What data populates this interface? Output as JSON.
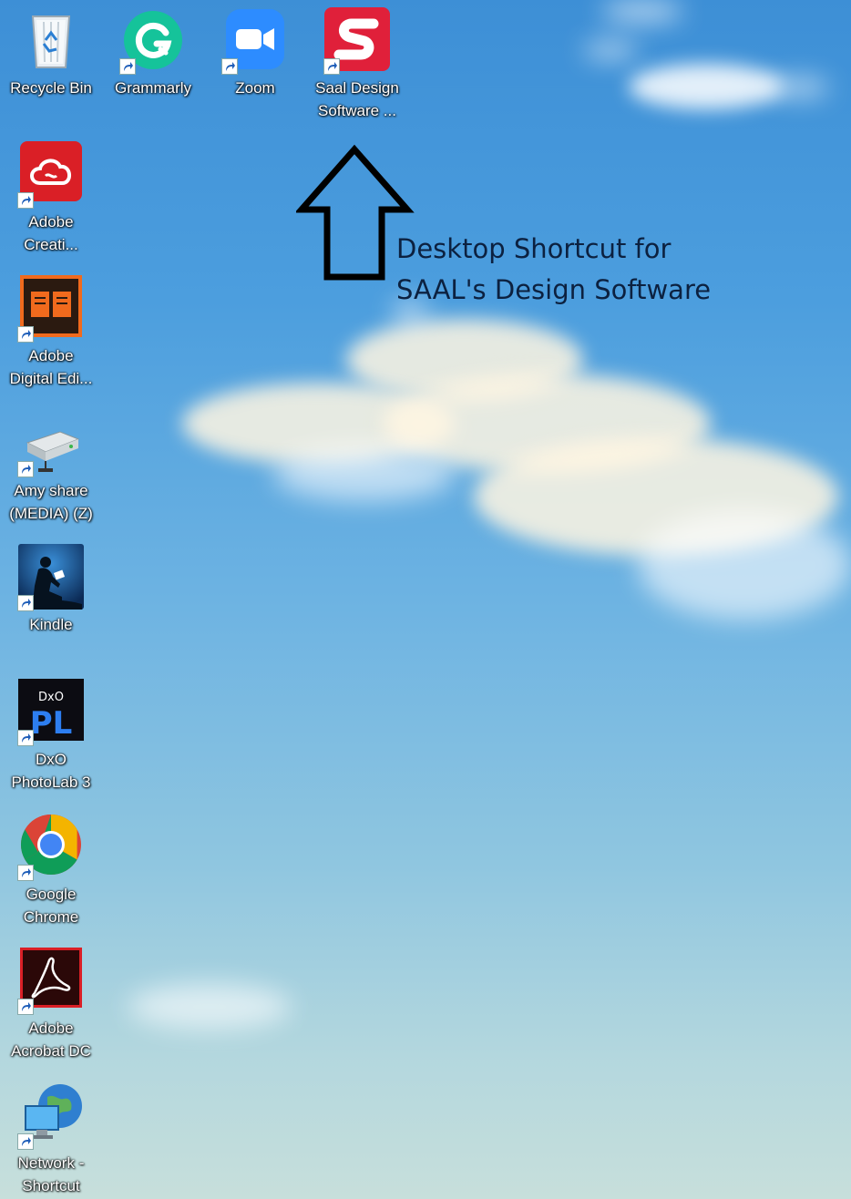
{
  "desktop": {
    "icons": [
      {
        "label": "Recycle Bin",
        "icon": "recycle-bin-icon",
        "shortcut": false
      },
      {
        "label": "Grammarly",
        "icon": "grammarly-icon",
        "shortcut": true
      },
      {
        "label": "Zoom",
        "icon": "zoom-icon",
        "shortcut": true
      },
      {
        "label": "Saal Design\nSoftware ...",
        "icon": "saal-design-icon",
        "shortcut": true
      },
      {
        "label": "Adobe\nCreati...",
        "icon": "adobe-creative-cloud-icon",
        "shortcut": true
      },
      {
        "label": "Adobe\nDigital Edi...",
        "icon": "adobe-digital-editions-icon",
        "shortcut": true
      },
      {
        "label": "Amy share\n(MEDIA) (Z)",
        "icon": "network-drive-icon",
        "shortcut": true
      },
      {
        "label": "Kindle",
        "icon": "kindle-icon",
        "shortcut": true
      },
      {
        "label": "DxO\nPhotoLab 3",
        "icon": "dxo-photolab-icon",
        "shortcut": true
      },
      {
        "label": "Google\nChrome",
        "icon": "google-chrome-icon",
        "shortcut": true
      },
      {
        "label": "Adobe\nAcrobat DC",
        "icon": "adobe-acrobat-icon",
        "shortcut": true
      },
      {
        "label": "Network -\nShortcut",
        "icon": "network-icon",
        "shortcut": true
      }
    ]
  },
  "annotation": {
    "text": "Desktop Shortcut for\nSAAL's Design Software",
    "arrow_icon": "up-arrow-icon"
  },
  "colors": {
    "saal_red": "#e0203a",
    "zoom_blue": "#2d8cff",
    "grammarly_green": "#15c39a",
    "adobe_red": "#da1f26",
    "annotation_text": "#0c2140"
  }
}
